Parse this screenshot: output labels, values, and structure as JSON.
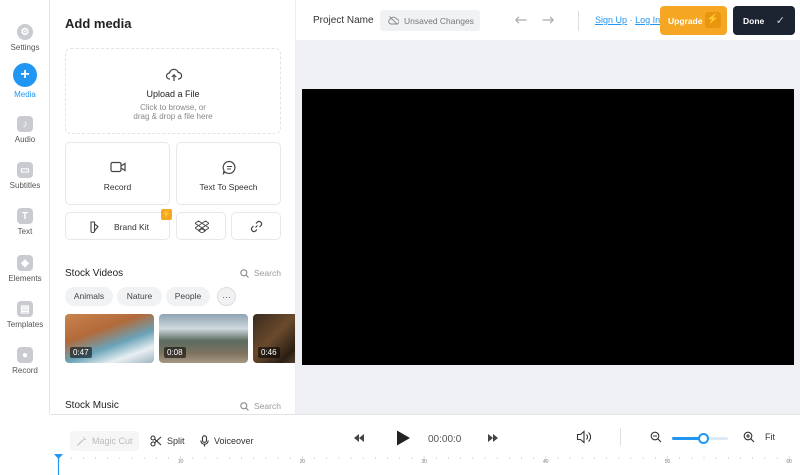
{
  "sidebar": {
    "items": [
      {
        "label": "Settings",
        "icon": "gear-icon"
      },
      {
        "label": "Media",
        "icon": "plus-icon",
        "active": true
      },
      {
        "label": "Audio",
        "icon": "music-note-icon"
      },
      {
        "label": "Subtitles",
        "icon": "subtitles-icon"
      },
      {
        "label": "Text",
        "icon": "text-icon"
      },
      {
        "label": "Elements",
        "icon": "shapes-icon"
      },
      {
        "label": "Templates",
        "icon": "template-icon"
      },
      {
        "label": "Record",
        "icon": "record-icon"
      }
    ]
  },
  "panel": {
    "title": "Add media",
    "upload": {
      "title": "Upload a File",
      "subtitle_line1": "Click to browse, or",
      "subtitle_line2": "drag & drop a file here"
    },
    "record_label": "Record",
    "tts_label": "Text To Speech",
    "brandkit_label": "Brand Kit",
    "stock_videos": {
      "title": "Stock Videos",
      "search": "Search",
      "chips": [
        "Animals",
        "Nature",
        "People"
      ],
      "more": "···",
      "thumbs": [
        {
          "duration": "0:47"
        },
        {
          "duration": "0:08"
        },
        {
          "duration": "0:46"
        }
      ]
    },
    "stock_music": {
      "title": "Stock Music",
      "search": "Search"
    }
  },
  "topbar": {
    "project_name": "Project Name",
    "unsaved": "Unsaved Changes",
    "sign_up": "Sign Up",
    "separator": "·",
    "log_in": "Log In",
    "upgrade": "Upgrade",
    "done": "Done"
  },
  "timeline": {
    "magic_cut": "Magic Cut",
    "split": "Split",
    "voiceover": "Voiceover",
    "time": "00:00:0",
    "fit": "Fit",
    "zoom_level": 0.55,
    "ruler_labels": [
      "10",
      "20",
      "30",
      "40",
      "50",
      "60"
    ]
  },
  "colors": {
    "accent": "#2196f3",
    "upgrade": "#f5a623",
    "done": "#1c2331",
    "stage_bg": "#eff0f3"
  }
}
